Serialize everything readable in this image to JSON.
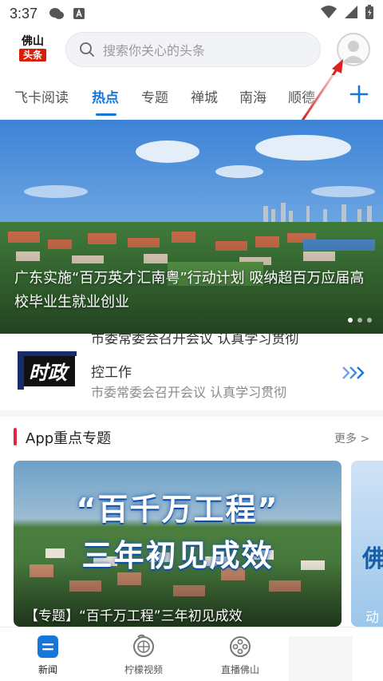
{
  "status_bar": {
    "time": "3:37"
  },
  "header": {
    "logo_line1": "佛山",
    "logo_line2": "头条",
    "search_placeholder": "搜索你关心的头条"
  },
  "tabs": [
    {
      "label": "飞卡阅读",
      "active": false
    },
    {
      "label": "热点",
      "active": true
    },
    {
      "label": "专题",
      "active": false
    },
    {
      "label": "禅城",
      "active": false
    },
    {
      "label": "南海",
      "active": false
    },
    {
      "label": "顺德",
      "active": false
    }
  ],
  "banner": {
    "title": "广东实施“百万英才汇南粤”行动计划 吸纳超百万应届高校毕业生就业创业",
    "dots": 3,
    "active_dot": 0
  },
  "shizheng": {
    "logo_text": "时政",
    "line_top": "市委常委会召开会议 认真学习贯彻",
    "line1": "控工作",
    "line2": "市委常委会召开会议 认真学习贯彻"
  },
  "section": {
    "title": "App重点专题",
    "more": "更多 >"
  },
  "cards": [
    {
      "headline_line1": "“百千万工程”",
      "headline_line2": "三年初见成效",
      "caption": "【专题】“百千万工程”三年初见成效"
    },
    {
      "headline_line1": "佛",
      "caption": "动"
    }
  ],
  "bottom_nav": [
    {
      "label": "新闻",
      "icon": "news-icon",
      "active": true
    },
    {
      "label": "柠檬视频",
      "icon": "lemon-video-icon",
      "active": false
    },
    {
      "label": "直播佛山",
      "icon": "film-reel-icon",
      "active": false
    }
  ],
  "colors": {
    "accent": "#1677d9",
    "section_bar": "#e5263a",
    "logo_red": "#d81e06"
  }
}
